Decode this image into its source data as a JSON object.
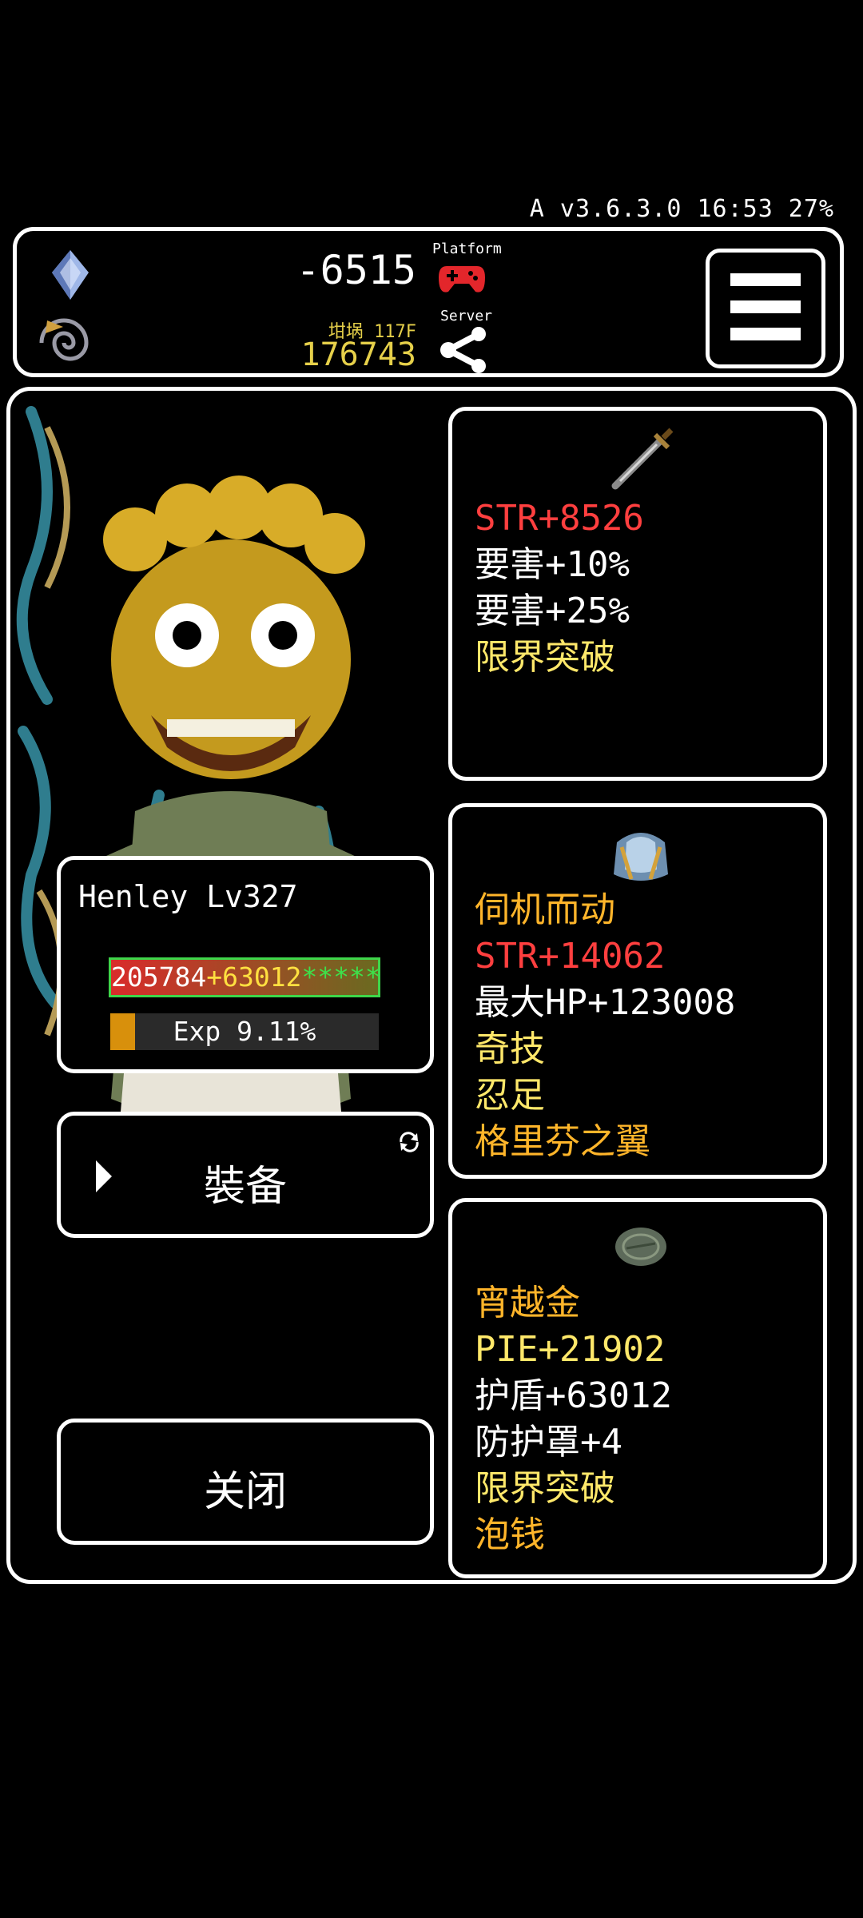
{
  "status_bar": {
    "text": "A v3.6.3.0 16:53 27%"
  },
  "top_bar": {
    "balance": "-6515",
    "floor_label": "坩埚 117F",
    "gold": "176743",
    "platform_label": "Platform",
    "server_label": "Server",
    "icons": [
      "crystal-icon",
      "swirl-icon",
      "gamepad-icon",
      "share-icon",
      "menu-icon"
    ]
  },
  "character": {
    "name": "Henley Lv327",
    "hp_text": "205784+63012*****",
    "hp_parts": {
      "hp": "205784",
      "shield": "+63012",
      "stars": "*****"
    },
    "exp_text": "Exp 9.11%",
    "exp_percent": 9.11
  },
  "buttons": {
    "equip": "裝备",
    "close": "关闭"
  },
  "items": [
    {
      "icon": "sword-icon",
      "lines": [
        {
          "text": "STR+8526",
          "color": "#ff3f3f"
        },
        {
          "text": "要害+10%",
          "color": "#ffffff"
        },
        {
          "text": "要害+25%",
          "color": "#ffffff"
        },
        {
          "text": "限界突破",
          "color": "#ffe86a"
        }
      ]
    },
    {
      "icon": "armor-icon",
      "lines": [
        {
          "text": "伺机而动",
          "color": "#ffb52a"
        },
        {
          "text": "STR+14062",
          "color": "#ff3f3f"
        },
        {
          "text": "最大HP+123008",
          "color": "#ffffff"
        },
        {
          "text": "奇技",
          "color": "#ffe86a"
        },
        {
          "text": "忍足",
          "color": "#ffe86a"
        },
        {
          "text": "格里芬之翼",
          "color": "#ffb52a"
        }
      ]
    },
    {
      "icon": "stone-icon",
      "lines": [
        {
          "text": "宵越金",
          "color": "#ffb52a"
        },
        {
          "text": "PIE+21902",
          "color": "#ffe86a"
        },
        {
          "text": "护盾+63012",
          "color": "#ffffff"
        },
        {
          "text": "防护罩+4",
          "color": "#ffffff"
        },
        {
          "text": "限界突破",
          "color": "#ffe86a"
        },
        {
          "text": "泡钱",
          "color": "#ffb52a"
        }
      ]
    }
  ]
}
